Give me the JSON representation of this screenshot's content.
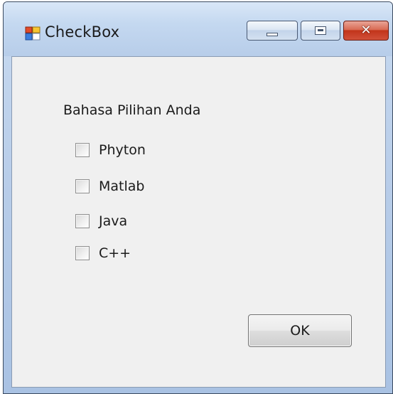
{
  "window": {
    "title": "CheckBox",
    "controls": {
      "minimize": "minimize-icon",
      "maximize": "maximize-icon",
      "close": "close-icon",
      "close_glyph": "✕"
    }
  },
  "form": {
    "group_label": "Bahasa Pilihan Anda",
    "checkboxes": [
      {
        "label": "Phyton",
        "checked": false
      },
      {
        "label": "Matlab",
        "checked": false
      },
      {
        "label": "Java",
        "checked": false
      },
      {
        "label": "C++",
        "checked": false
      }
    ],
    "ok_button": "OK"
  },
  "colors": {
    "client_background": "#f0f0f0",
    "title_gradient_top": "#d9e7f7",
    "close_button": "#c2351b"
  }
}
